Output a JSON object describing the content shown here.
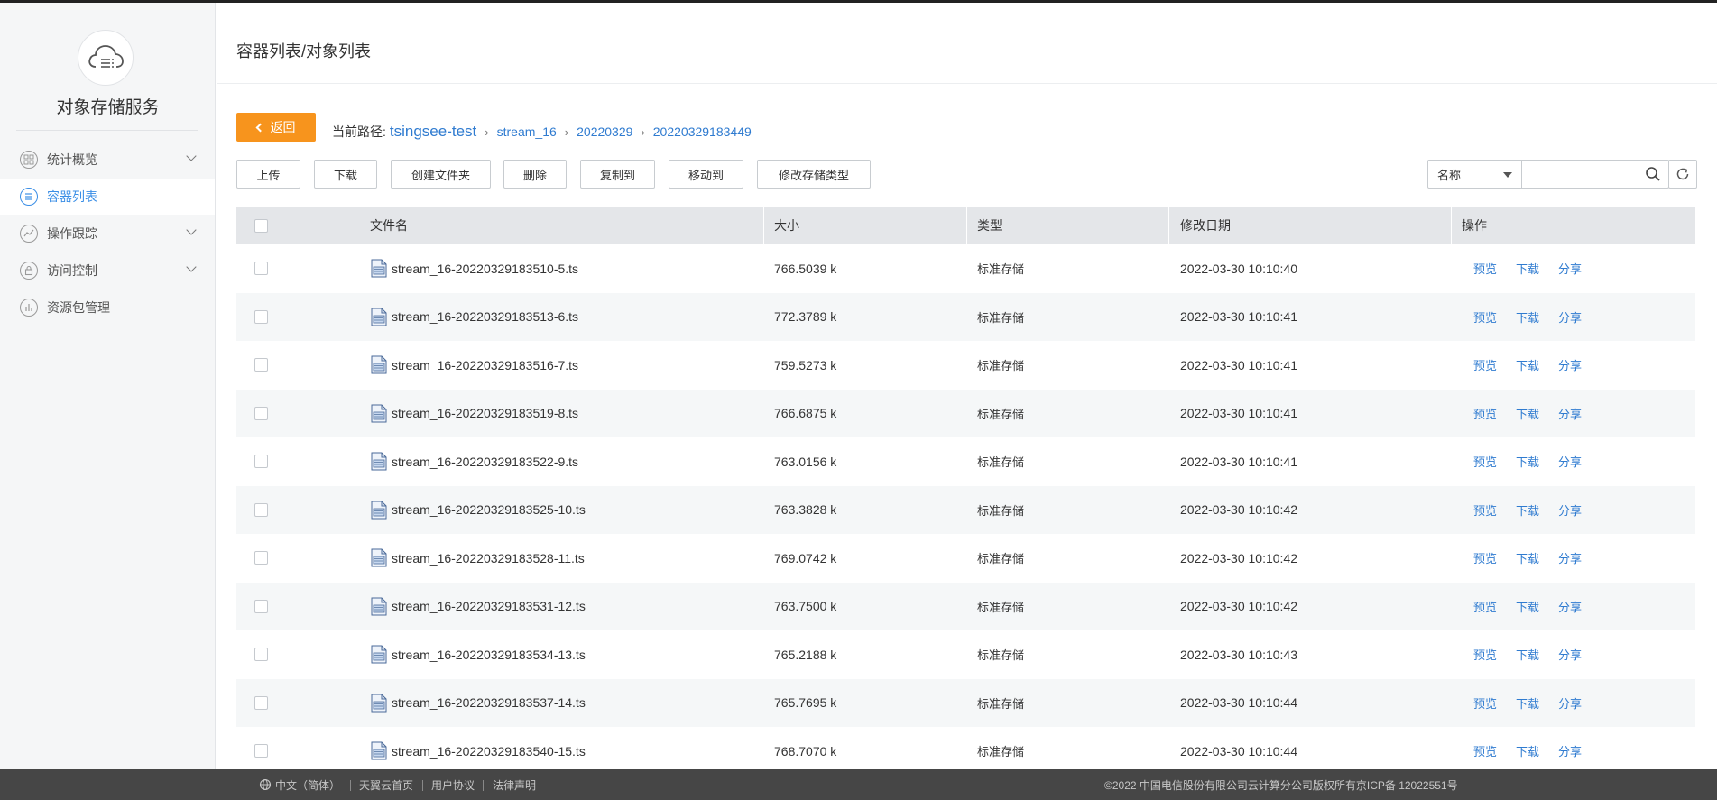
{
  "app": {
    "title": "对象存储服务"
  },
  "sidebar": {
    "items": [
      {
        "label": "统计概览",
        "icon": "dashboard-icon",
        "expandable": true,
        "active": false
      },
      {
        "label": "容器列表",
        "icon": "container-icon",
        "expandable": false,
        "active": true
      },
      {
        "label": "操作跟踪",
        "icon": "trace-icon",
        "expandable": true,
        "active": false
      },
      {
        "label": "访问控制",
        "icon": "access-control-icon",
        "expandable": true,
        "active": false
      },
      {
        "label": "资源包管理",
        "icon": "package-icon",
        "expandable": false,
        "active": false
      }
    ]
  },
  "header": {
    "title": "容器列表/对象列表"
  },
  "nav": {
    "back_label": "返回",
    "path_label": "当前路径:",
    "path_root": "tsingsee-test",
    "path_segments": [
      "stream_16",
      "20220329",
      "20220329183449"
    ]
  },
  "toolbar": {
    "buttons": [
      "上传",
      "下载",
      "创建文件夹",
      "删除",
      "复制到",
      "移动到",
      "修改存储类型"
    ]
  },
  "search": {
    "field_selected": "名称",
    "placeholder": ""
  },
  "table": {
    "columns": [
      "文件名",
      "大小",
      "类型",
      "修改日期",
      "操作"
    ],
    "actions": [
      "预览",
      "下载",
      "分享"
    ],
    "rows": [
      {
        "name": "stream_16-20220329183510-5.ts",
        "size": "766.5039 k",
        "type": "标准存储",
        "date": "2022-03-30 10:10:40"
      },
      {
        "name": "stream_16-20220329183513-6.ts",
        "size": "772.3789 k",
        "type": "标准存储",
        "date": "2022-03-30 10:10:41"
      },
      {
        "name": "stream_16-20220329183516-7.ts",
        "size": "759.5273 k",
        "type": "标准存储",
        "date": "2022-03-30 10:10:41"
      },
      {
        "name": "stream_16-20220329183519-8.ts",
        "size": "766.6875 k",
        "type": "标准存储",
        "date": "2022-03-30 10:10:41"
      },
      {
        "name": "stream_16-20220329183522-9.ts",
        "size": "763.0156 k",
        "type": "标准存储",
        "date": "2022-03-30 10:10:41"
      },
      {
        "name": "stream_16-20220329183525-10.ts",
        "size": "763.3828 k",
        "type": "标准存储",
        "date": "2022-03-30 10:10:42"
      },
      {
        "name": "stream_16-20220329183528-11.ts",
        "size": "769.0742 k",
        "type": "标准存储",
        "date": "2022-03-30 10:10:42"
      },
      {
        "name": "stream_16-20220329183531-12.ts",
        "size": "763.7500 k",
        "type": "标准存储",
        "date": "2022-03-30 10:10:42"
      },
      {
        "name": "stream_16-20220329183534-13.ts",
        "size": "765.2188 k",
        "type": "标准存储",
        "date": "2022-03-30 10:10:43"
      },
      {
        "name": "stream_16-20220329183537-14.ts",
        "size": "765.7695 k",
        "type": "标准存储",
        "date": "2022-03-30 10:10:44"
      },
      {
        "name": "stream_16-20220329183540-15.ts",
        "size": "768.7070 k",
        "type": "标准存储",
        "date": "2022-03-30 10:10:44"
      }
    ]
  },
  "footer": {
    "language": "中文（简体）",
    "links": [
      "天翼云首页",
      "用户协议",
      "法律声明"
    ],
    "copyright": "©2022 中国电信股份有限公司云计算分公司版权所有京ICP备 12022551号"
  },
  "colors": {
    "accent": "#2f7bd0",
    "back_button": "#f7941d",
    "footer_bg": "#464646",
    "sidebar_bg": "#f5f6f7",
    "table_header_bg": "#e4e6e9"
  }
}
